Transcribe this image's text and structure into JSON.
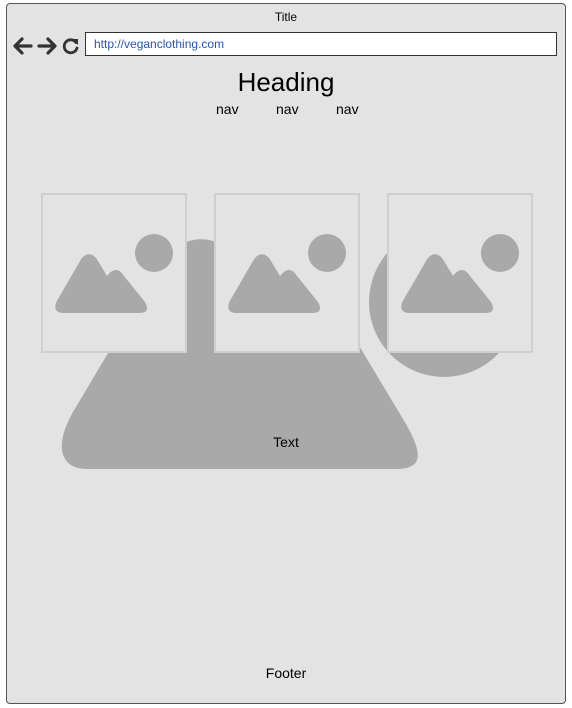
{
  "window": {
    "title": "Title"
  },
  "toolbar": {
    "back_icon": "arrow-left-icon",
    "forward_icon": "arrow-right-icon",
    "reload_icon": "reload-icon",
    "url": "http://veganclothing.com"
  },
  "page": {
    "heading": "Heading",
    "nav": [
      "nav",
      "nav",
      "nav"
    ],
    "text": "Text",
    "footer": "Footer"
  },
  "colors": {
    "window_bg": "#e3e3e3",
    "placeholder_gray": "#a9a9a9",
    "url_text": "#2a52be"
  }
}
